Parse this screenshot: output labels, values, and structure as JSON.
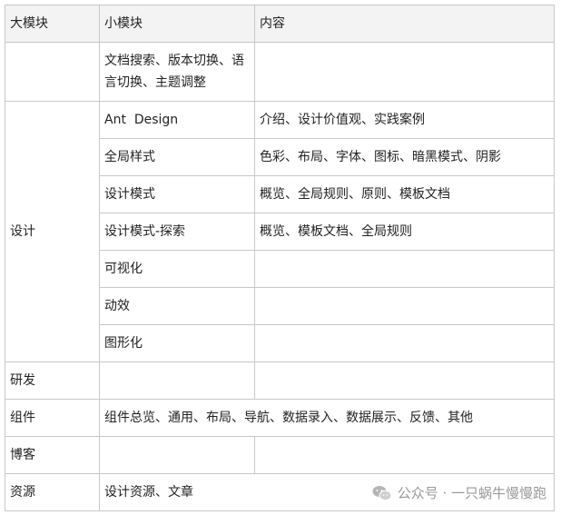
{
  "table": {
    "headers": [
      "大模块",
      "小模块",
      "内容"
    ],
    "rows": [
      {
        "major": "",
        "minor": "文档搜索、版本切换、语言切换、主题调整",
        "content": ""
      },
      {
        "major": "设计",
        "minor": "Ant  Design",
        "content": "介绍、设计价值观、实践案例"
      },
      {
        "minor": "全局样式",
        "content": "色彩、布局、字体、图标、暗黑模式、阴影"
      },
      {
        "minor": "设计模式",
        "content": "概览、全局规则、原则、模板文档"
      },
      {
        "minor": "设计模式-探索",
        "content": "概览、模板文档、全局规则"
      },
      {
        "minor": "可视化",
        "content": ""
      },
      {
        "minor": "动效",
        "content": ""
      },
      {
        "minor": "图形化",
        "content": ""
      },
      {
        "major": "研发",
        "minor": "",
        "content": ""
      },
      {
        "major": "组件",
        "merged": "组件总览、通用、布局、导航、数据录入、数据展示、反馈、其他"
      },
      {
        "major": "博客",
        "minor": "",
        "content": ""
      },
      {
        "major": "资源",
        "merged": "设计资源、文章"
      }
    ]
  },
  "watermark": {
    "icon": "wechat-icon",
    "text": "公众号 · 一只蜗牛慢慢跑"
  }
}
